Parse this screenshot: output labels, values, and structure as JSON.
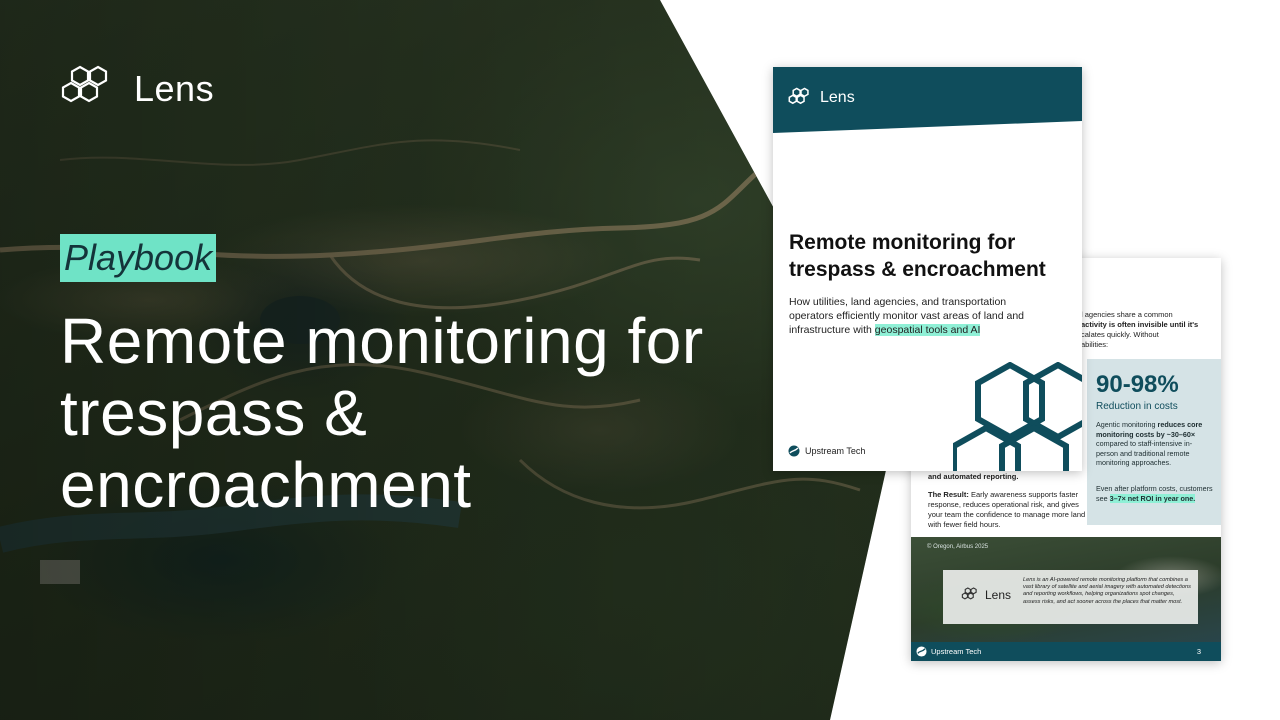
{
  "brand": {
    "name": "Lens",
    "logo_icon": "hexagon-cluster-icon",
    "accent_color": "#6fe3c6",
    "primary_color": "#0f4d5c"
  },
  "hero": {
    "tag": "Playbook",
    "title": "Remote monitoring for trespass & encroachment"
  },
  "cover_page": {
    "brand_name": "Lens",
    "title": "Remote monitoring for trespass & encroachment",
    "subtitle_text": "How utilities, land agencies, and transportation operators efficiently monitor vast areas of land and infrastructure with",
    "subtitle_highlight": "geospatial tools and AI",
    "footer_company": "Upstream Tech"
  },
  "back_page": {
    "intro_line1": "l agencies share a common",
    "intro_line2": "activity is often invisible until it's",
    "intro_line3": "calates quickly. Without",
    "intro_line4": "abilities:",
    "stat_value": "90-98%",
    "stat_label": "Reduction in costs",
    "stat_body_prefix": "Agentic monitoring",
    "stat_body_bold": "reduces core monitoring costs by ~30–60×",
    "stat_body_suffix": "compared to staff-intensive in-person and traditional remote monitoring approaches.",
    "roi_prefix": "Even after platform costs, customers see",
    "roi_highlight": "3–7× net ROI in year one.",
    "left_line1": "and automated reporting.",
    "result_label": "The Result:",
    "result_text": "Early awareness supports faster response, reduces operational risk, and gives your team the confidence to manage more land with fewer field hours.",
    "photo_credit": "© Oregon, Airbus 2025",
    "card_brand": "Lens",
    "card_description": "Lens is an AI-powered remote monitoring platform that combines a vast library of satellite and aerial imagery with automated detections and reporting workflows, helping organizations spot changes, assess risks, and act sooner across the places that matter most.",
    "footer_company": "Upstream Tech",
    "page_number": "3"
  }
}
